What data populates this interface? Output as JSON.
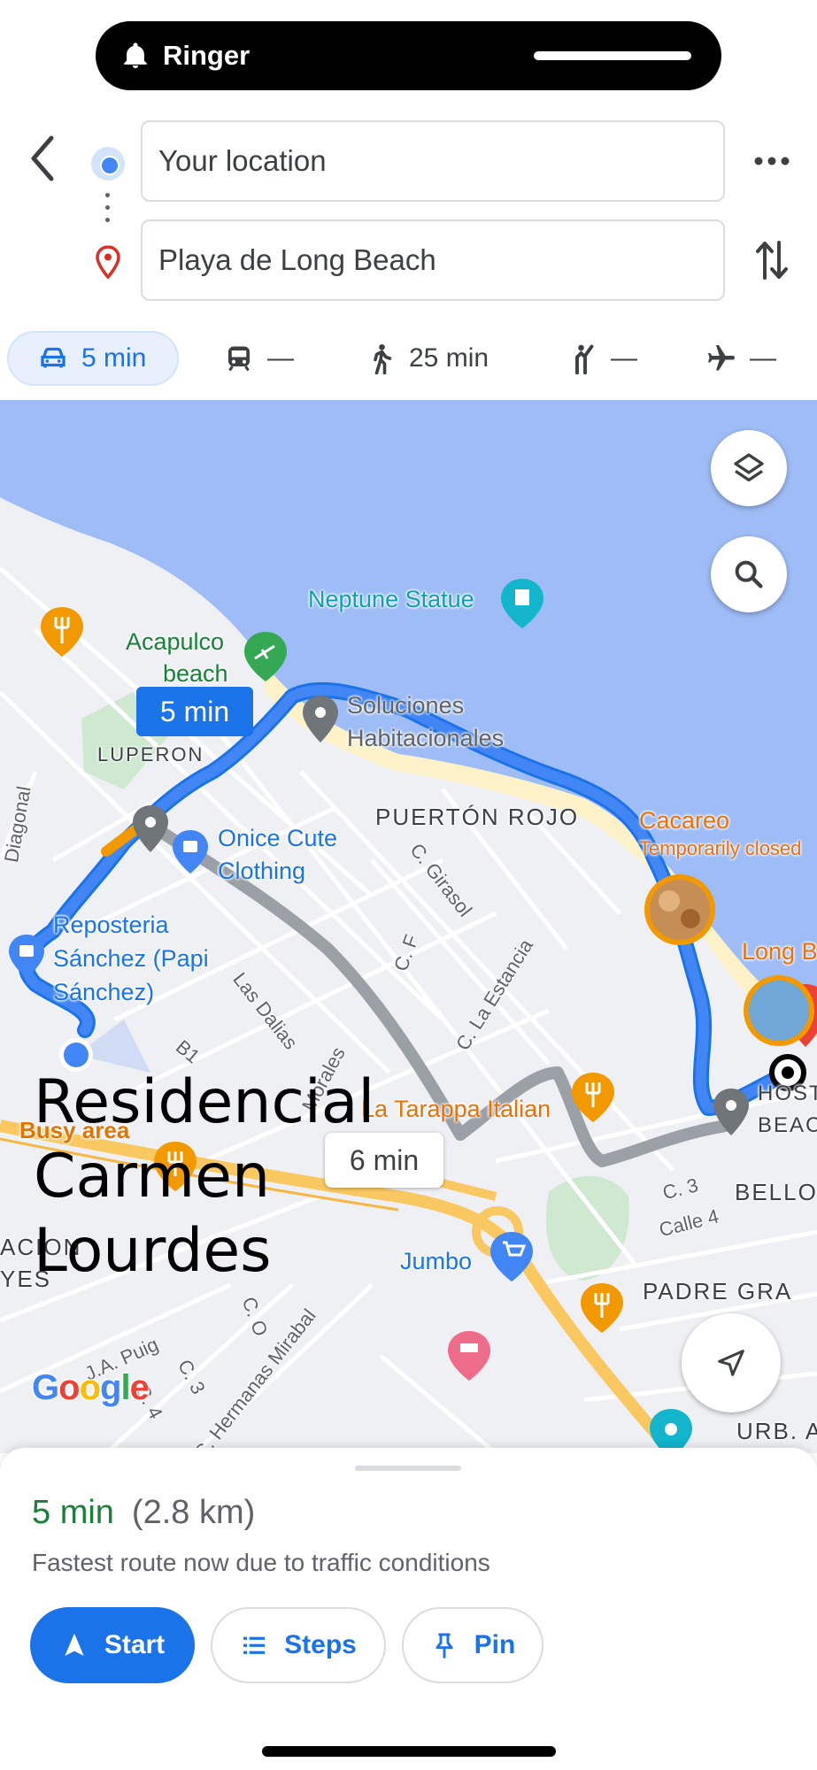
{
  "status": {
    "ringer_label": "Ringer"
  },
  "search": {
    "origin": "Your location",
    "destination": "Playa de Long Beach"
  },
  "modes": [
    {
      "name": "car",
      "label": "5 min",
      "selected": true
    },
    {
      "name": "transit",
      "label": "—"
    },
    {
      "name": "walk",
      "label": "25 min"
    },
    {
      "name": "ride",
      "label": "—"
    },
    {
      "name": "flight",
      "label": "—"
    }
  ],
  "map": {
    "route_chip_primary": "5 min",
    "route_chip_alt": "6 min",
    "busy_label": "Busy area",
    "overlay_text_lines": [
      "Residencial",
      "Carmen",
      "Lourdes"
    ],
    "attribution": "Google",
    "labels": {
      "neptune": "Neptune Statue",
      "acapulco_1": "Acapulco",
      "acapulco_2": "beach",
      "soluciones_1": "Soluciones",
      "soluciones_2": "Habitacionales",
      "luperon": "LUPERON",
      "puerton": "PUERTÓN ROJO",
      "cacareo": "Cacareo",
      "cacareo_status": "Temporarily closed",
      "onice_1": "Onice Cute",
      "onice_2": "Clothing",
      "reposteria_1": "Reposteria",
      "reposteria_2": "Sánchez (Papi",
      "reposteria_3": "Sánchez)",
      "long_beach": "Long B",
      "hostal_1": "HOST",
      "hostal_2": "BEAC",
      "tarappa": "La Tarappa Italian",
      "jumbo": "Jumbo",
      "bello": "BELLO",
      "padre": "PADRE GRA",
      "urb": "URB. A",
      "acion": "ACION",
      "yes": "YES",
      "diagonal": "Diagonal",
      "girasol": "C. Girasol",
      "cf": "C. F",
      "estancia": "C. La Estancia",
      "dalias": "Las Dalias",
      "morales": "Morales",
      "b1": "B1",
      "c3_east": "C. 3",
      "calle4": "Calle 4",
      "co": "C. O",
      "c3_west": "C. 3",
      "c4": "C. 4",
      "japuig": "J.A. Puig",
      "hermanas": "C. Hermanas Mirabal"
    }
  },
  "sheet": {
    "duration": "5 min",
    "distance": "(2.8 km)",
    "reason": "Fastest route now due to traffic conditions",
    "start_label": "Start",
    "steps_label": "Steps",
    "pin_label": "Pin"
  },
  "colors": {
    "accent": "#1a73e8",
    "route_primary": "#4285f4",
    "route_alt": "#9aa0a6",
    "water": "#9ebcf5",
    "positive": "#188038"
  },
  "icons": [
    "bell-icon",
    "back-icon",
    "more-icon",
    "swap-icon",
    "car-icon",
    "transit-icon",
    "walk-icon",
    "ride-icon",
    "flight-icon",
    "layers-icon",
    "search-icon",
    "recenter-icon",
    "navigate-icon",
    "list-icon",
    "pin-icon"
  ]
}
